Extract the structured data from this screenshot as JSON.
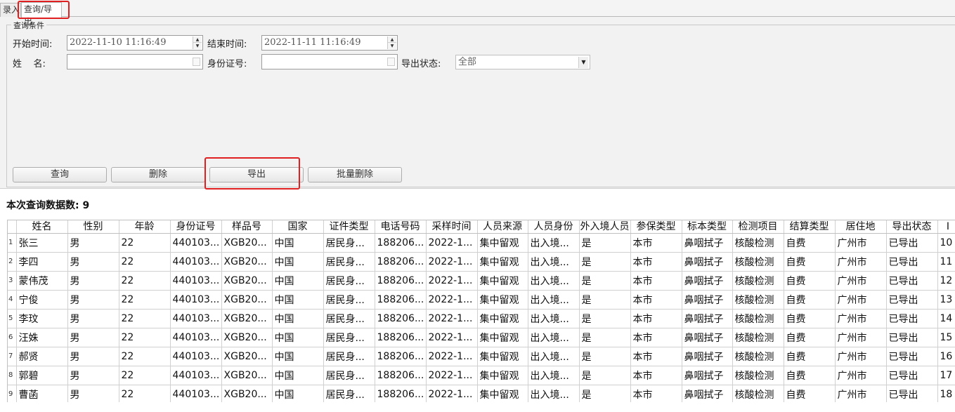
{
  "tabs": [
    {
      "label": "录入"
    },
    {
      "label": "查询/导出"
    }
  ],
  "group_title": "查询条件",
  "form": {
    "start_label": "开始时间:",
    "start_value": "2022-11-10 11:16:49",
    "end_label": "结束时间:",
    "end_value": "2022-11-11 11:16:49",
    "name_label": "姓    名:",
    "name_value": "",
    "id_label": "身份证号:",
    "id_value": "",
    "status_label": "导出状态:",
    "status_value": "全部"
  },
  "buttons": {
    "query": "查询",
    "delete": "删除",
    "export": "导出",
    "batch_delete": "批量删除"
  },
  "count": {
    "label": "本次查询数据数:",
    "value": "9"
  },
  "table": {
    "headers": [
      "",
      "姓名",
      "性别",
      "年龄",
      "身份证号",
      "样品号",
      "国家",
      "证件类型",
      "电话号码",
      "采样时间",
      "人员来源",
      "人员身份",
      "外入境人员",
      "参保类型",
      "标本类型",
      "检测项目",
      "结算类型",
      "居住地",
      "导出状态",
      "I"
    ],
    "rows": [
      [
        "1",
        "张三",
        "男",
        "22",
        "440103...",
        "XGB20...",
        "中国",
        "居民身...",
        "188206...",
        "2022-1...",
        "集中留观",
        "出入境...",
        "是",
        "本市",
        "鼻咽拭子",
        "核酸检测",
        "自费",
        "广州市",
        "已导出",
        "10"
      ],
      [
        "2",
        "李四",
        "男",
        "22",
        "440103...",
        "XGB20...",
        "中国",
        "居民身...",
        "188206...",
        "2022-1...",
        "集中留观",
        "出入境...",
        "是",
        "本市",
        "鼻咽拭子",
        "核酸检测",
        "自费",
        "广州市",
        "已导出",
        "11"
      ],
      [
        "3",
        "蒙伟茂",
        "男",
        "22",
        "440103...",
        "XGB20...",
        "中国",
        "居民身...",
        "188206...",
        "2022-1...",
        "集中留观",
        "出入境...",
        "是",
        "本市",
        "鼻咽拭子",
        "核酸检测",
        "自费",
        "广州市",
        "已导出",
        "12"
      ],
      [
        "4",
        "宁俊",
        "男",
        "22",
        "440103...",
        "XGB20...",
        "中国",
        "居民身...",
        "188206...",
        "2022-1...",
        "集中留观",
        "出入境...",
        "是",
        "本市",
        "鼻咽拭子",
        "核酸检测",
        "自费",
        "广州市",
        "已导出",
        "13"
      ],
      [
        "5",
        "李玟",
        "男",
        "22",
        "440103...",
        "XGB20...",
        "中国",
        "居民身...",
        "188206...",
        "2022-1...",
        "集中留观",
        "出入境...",
        "是",
        "本市",
        "鼻咽拭子",
        "核酸检测",
        "自费",
        "广州市",
        "已导出",
        "14"
      ],
      [
        "6",
        "汪姝",
        "男",
        "22",
        "440103...",
        "XGB20...",
        "中国",
        "居民身...",
        "188206...",
        "2022-1...",
        "集中留观",
        "出入境...",
        "是",
        "本市",
        "鼻咽拭子",
        "核酸检测",
        "自费",
        "广州市",
        "已导出",
        "15"
      ],
      [
        "7",
        "郝贤",
        "男",
        "22",
        "440103...",
        "XGB20...",
        "中国",
        "居民身...",
        "188206...",
        "2022-1...",
        "集中留观",
        "出入境...",
        "是",
        "本市",
        "鼻咽拭子",
        "核酸检测",
        "自费",
        "广州市",
        "已导出",
        "16"
      ],
      [
        "8",
        "郭碧",
        "男",
        "22",
        "440103...",
        "XGB20...",
        "中国",
        "居民身...",
        "188206...",
        "2022-1...",
        "集中留观",
        "出入境...",
        "是",
        "本市",
        "鼻咽拭子",
        "核酸检测",
        "自费",
        "广州市",
        "已导出",
        "17"
      ],
      [
        "9",
        "曹菡",
        "男",
        "22",
        "440103...",
        "XGB20...",
        "中国",
        "居民身...",
        "188206...",
        "2022-1...",
        "集中留观",
        "出入境...",
        "是",
        "本市",
        "鼻咽拭子",
        "核酸检测",
        "自费",
        "广州市",
        "已导出",
        "18"
      ]
    ]
  },
  "colors": {
    "highlight": "#e02020",
    "panel": "#f2f2f2"
  }
}
